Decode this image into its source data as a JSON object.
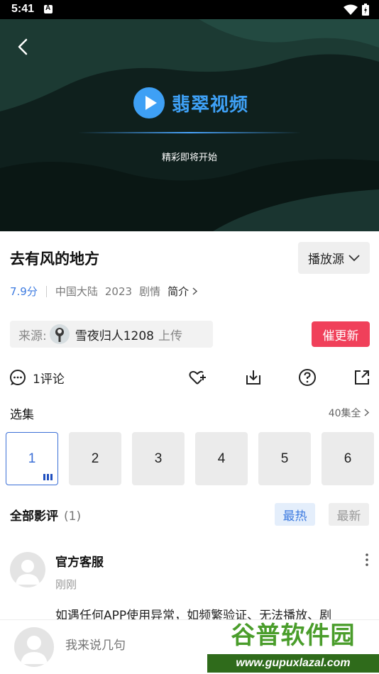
{
  "status_bar": {
    "time": "5:41"
  },
  "player": {
    "brand_name": "翡翠视频",
    "loading_text": "精彩即将开始"
  },
  "video": {
    "title": "去有风的地方",
    "source_button": "播放源",
    "score": "7.9分",
    "region": "中国大陆",
    "year": "2023",
    "genre": "剧情",
    "intro_link": "简介"
  },
  "uploader": {
    "label": "来源:",
    "name": "雪夜归人1208",
    "action": "上传"
  },
  "urge_button": "催更新",
  "comments": {
    "count_label": "1评论"
  },
  "actions": [
    "favorite-icon",
    "download-icon",
    "help-icon",
    "share-icon"
  ],
  "episodes": {
    "heading": "选集",
    "all_label": "40集全",
    "items": [
      "1",
      "2",
      "3",
      "4",
      "5",
      "6"
    ],
    "active_index": 0
  },
  "reviews": {
    "heading": "全部影评",
    "count": "(1)",
    "tab_hot": "最热",
    "tab_new": "最新",
    "items": [
      {
        "author": "官方客服",
        "time": "刚刚",
        "text": "如遇任何APP使用异常，如频繁验证、无法播放、剧"
      }
    ]
  },
  "input": {
    "placeholder": "我来说几句"
  },
  "watermark": {
    "title": "谷普软件园",
    "url": "www.gupuxlazal.com"
  },
  "colors": {
    "accent": "#3d7be0",
    "urge": "#f0405a",
    "player_bg": "#0e1f1c"
  }
}
